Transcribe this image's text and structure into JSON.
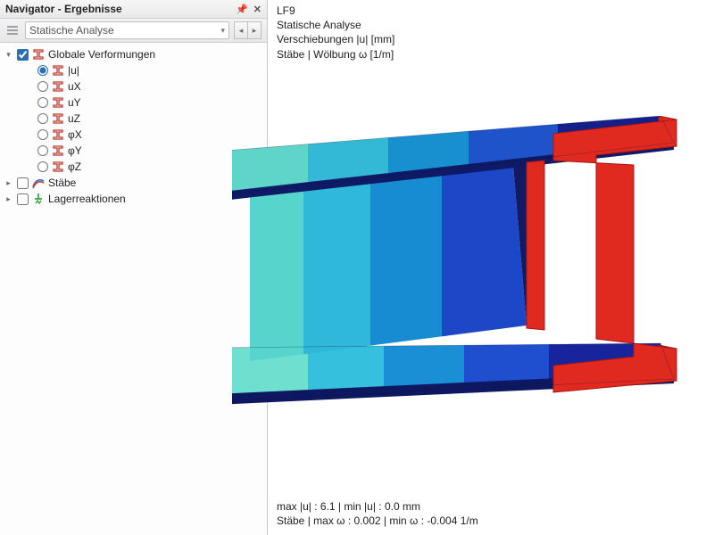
{
  "panel": {
    "title": "Navigator - Ergebnisse",
    "pin_tooltip": "Pin",
    "close_tooltip": "Schließen"
  },
  "toolbar": {
    "analysis_label": "Statische Analyse",
    "prev_tooltip": "Zurück",
    "next_tooltip": "Weiter"
  },
  "tree": {
    "root": {
      "label": "Globale Verformungen",
      "checked": true,
      "expanded": true,
      "items": [
        {
          "key": "u",
          "label": "|u|",
          "selected": true
        },
        {
          "key": "ux",
          "label": "uX",
          "selected": false
        },
        {
          "key": "uy",
          "label": "uY",
          "selected": false
        },
        {
          "key": "uz",
          "label": "uZ",
          "selected": false
        },
        {
          "key": "phix",
          "label": "φX",
          "selected": false
        },
        {
          "key": "phiy",
          "label": "φY",
          "selected": false
        },
        {
          "key": "phiz",
          "label": "φZ",
          "selected": false
        }
      ]
    },
    "siblings": [
      {
        "key": "staebe",
        "label": "Stäbe",
        "checked": false,
        "expanded": false,
        "icon": "member-icon"
      },
      {
        "key": "lager",
        "label": "Lagerreaktionen",
        "checked": false,
        "expanded": false,
        "icon": "support-icon"
      }
    ]
  },
  "viewport": {
    "top_lines": [
      "LF9",
      "Statische Analyse",
      "Verschiebungen |u| [mm]",
      "Stäbe | Wölbung ω [1/m]"
    ],
    "bottom_lines": [
      "max |u| : 6.1 | min |u| : 0.0 mm",
      "Stäbe | max ω : 0.002 | min ω : -0.004 1/m"
    ]
  },
  "colors": {
    "beam_bands": [
      "#5fd4c8",
      "#33b9d5",
      "#1890d0",
      "#1f53c9",
      "#1b2fa0",
      "#101a66"
    ],
    "end_cap": "#e02a1f"
  }
}
